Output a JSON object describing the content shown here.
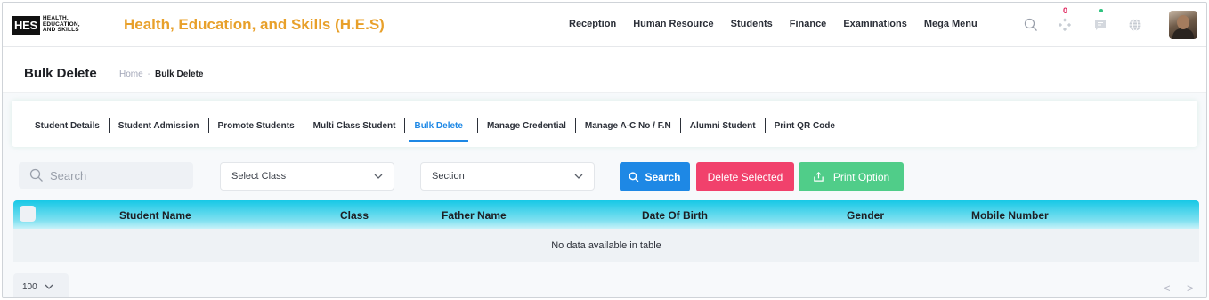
{
  "header": {
    "logo_box": "HES",
    "logo_line1": "HEALTH,",
    "logo_line2": "EDUCATION,",
    "logo_line3": "AND SKILLS",
    "app_title": "Health, Education, and Skills (H.E.S)",
    "nav": [
      "Reception",
      "Human Resource",
      "Students",
      "Finance",
      "Examinations",
      "Mega Menu"
    ],
    "notification_count": "0",
    "icons": [
      "search-icon",
      "apps-icon",
      "chat-icon",
      "globe-icon",
      "avatar"
    ]
  },
  "subheader": {
    "title": "Bulk Delete",
    "breadcrumb_home": "Home",
    "breadcrumb_sep": "-",
    "breadcrumb_current": "Bulk Delete"
  },
  "tabs": [
    {
      "label": "Student Details",
      "active": false
    },
    {
      "label": "Student Admission",
      "active": false
    },
    {
      "label": "Promote Students",
      "active": false
    },
    {
      "label": "Multi Class Student",
      "active": false
    },
    {
      "label": "Bulk Delete",
      "active": true
    },
    {
      "label": "Manage Credential",
      "active": false
    },
    {
      "label": "Manage A-C No / F.N",
      "active": false
    },
    {
      "label": "Alumni Student",
      "active": false
    },
    {
      "label": "Print QR Code",
      "active": false
    }
  ],
  "filters": {
    "search_placeholder": "Search",
    "class_select": "Select Class",
    "section_select": "Section",
    "search_button": "Search",
    "delete_button": "Delete Selected",
    "print_button": "Print Option"
  },
  "table": {
    "columns": [
      "Student Name",
      "Class",
      "Father Name",
      "Date Of Birth",
      "Gender",
      "Mobile Number"
    ],
    "empty_text": "No data available in table"
  },
  "pagination": {
    "page_size": "100",
    "prev": "<",
    "next": ">"
  },
  "colors": {
    "brand": "#e8a02a",
    "primary": "#1e88e5",
    "danger": "#f1416c",
    "success": "#50cd89",
    "table_header": "#17c8e6"
  }
}
